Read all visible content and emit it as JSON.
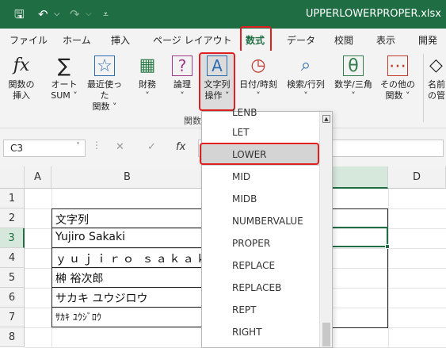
{
  "title": "UPPERLOWERPROPER.xlsx",
  "quick_access": {
    "save": "🖫",
    "undo": "↶",
    "undo_menu": "⌵",
    "redo": "↷",
    "redo_menu": "⌵",
    "customize": "⩡"
  },
  "tabs": [
    "ファイル",
    "ホーム",
    "挿入",
    "ページ レイアウト",
    "数式",
    "データ",
    "校閲",
    "表示",
    "開発"
  ],
  "active_tab": "数式",
  "ribbon": {
    "buttons": [
      {
        "icon": "fx",
        "l1": "関数の",
        "l2": "挿入"
      },
      {
        "icon": "∑",
        "l1": "オート",
        "l2": "SUM ˅"
      },
      {
        "icon": "☆",
        "l1": "最近使った",
        "l2": "関数 ˅"
      },
      {
        "icon": "▦",
        "l1": "財務",
        "l2": "˅"
      },
      {
        "icon": "?",
        "l1": "論理",
        "l2": "˅"
      },
      {
        "icon": "A",
        "l1": "文字列",
        "l2": "操作 ˅"
      },
      {
        "icon": "◷",
        "l1": "日付/時刻",
        "l2": "˅"
      },
      {
        "icon": "⌕",
        "l1": "検索/行列",
        "l2": "˅"
      },
      {
        "icon": "θ",
        "l1": "数学/三角",
        "l2": "˅"
      },
      {
        "icon": "⋯",
        "l1": "その他の",
        "l2": "関数 ˅"
      },
      {
        "icon": "◇",
        "l1": "名前",
        "l2": "の管"
      }
    ],
    "group_label": "関数"
  },
  "formula_bar": {
    "name_box": "C3",
    "name_arrow": "˅",
    "sep": "⋮",
    "cancel": "✕",
    "enter": "✓",
    "fx": "fx"
  },
  "columns": [
    "A",
    "B",
    "C",
    "D"
  ],
  "rows": [
    "1",
    "2",
    "3",
    "4",
    "5",
    "6",
    "7",
    "8"
  ],
  "cells": {
    "b2": "文字列",
    "b3": "Yujiro Sakaki",
    "b4": "ｙｕｊｉｒｏ ｓａｋａｋ",
    "b5": "榊 裕次郎",
    "b6": "サカキ ユウジロウ",
    "b7": "ｻｶｷ ﾕｳｼﾞﾛｳ"
  },
  "dropdown": {
    "top_partial": "LENB",
    "items": [
      "LET",
      "LOWER",
      "MID",
      "MIDB",
      "NUMBERVALUE",
      "PROPER",
      "REPLACE",
      "REPLACEB",
      "REPT",
      "RIGHT"
    ],
    "highlighted": "LOWER",
    "scroll_up": "▲"
  },
  "accent_color": "#1f6e43",
  "highlight_color": "#e02020"
}
